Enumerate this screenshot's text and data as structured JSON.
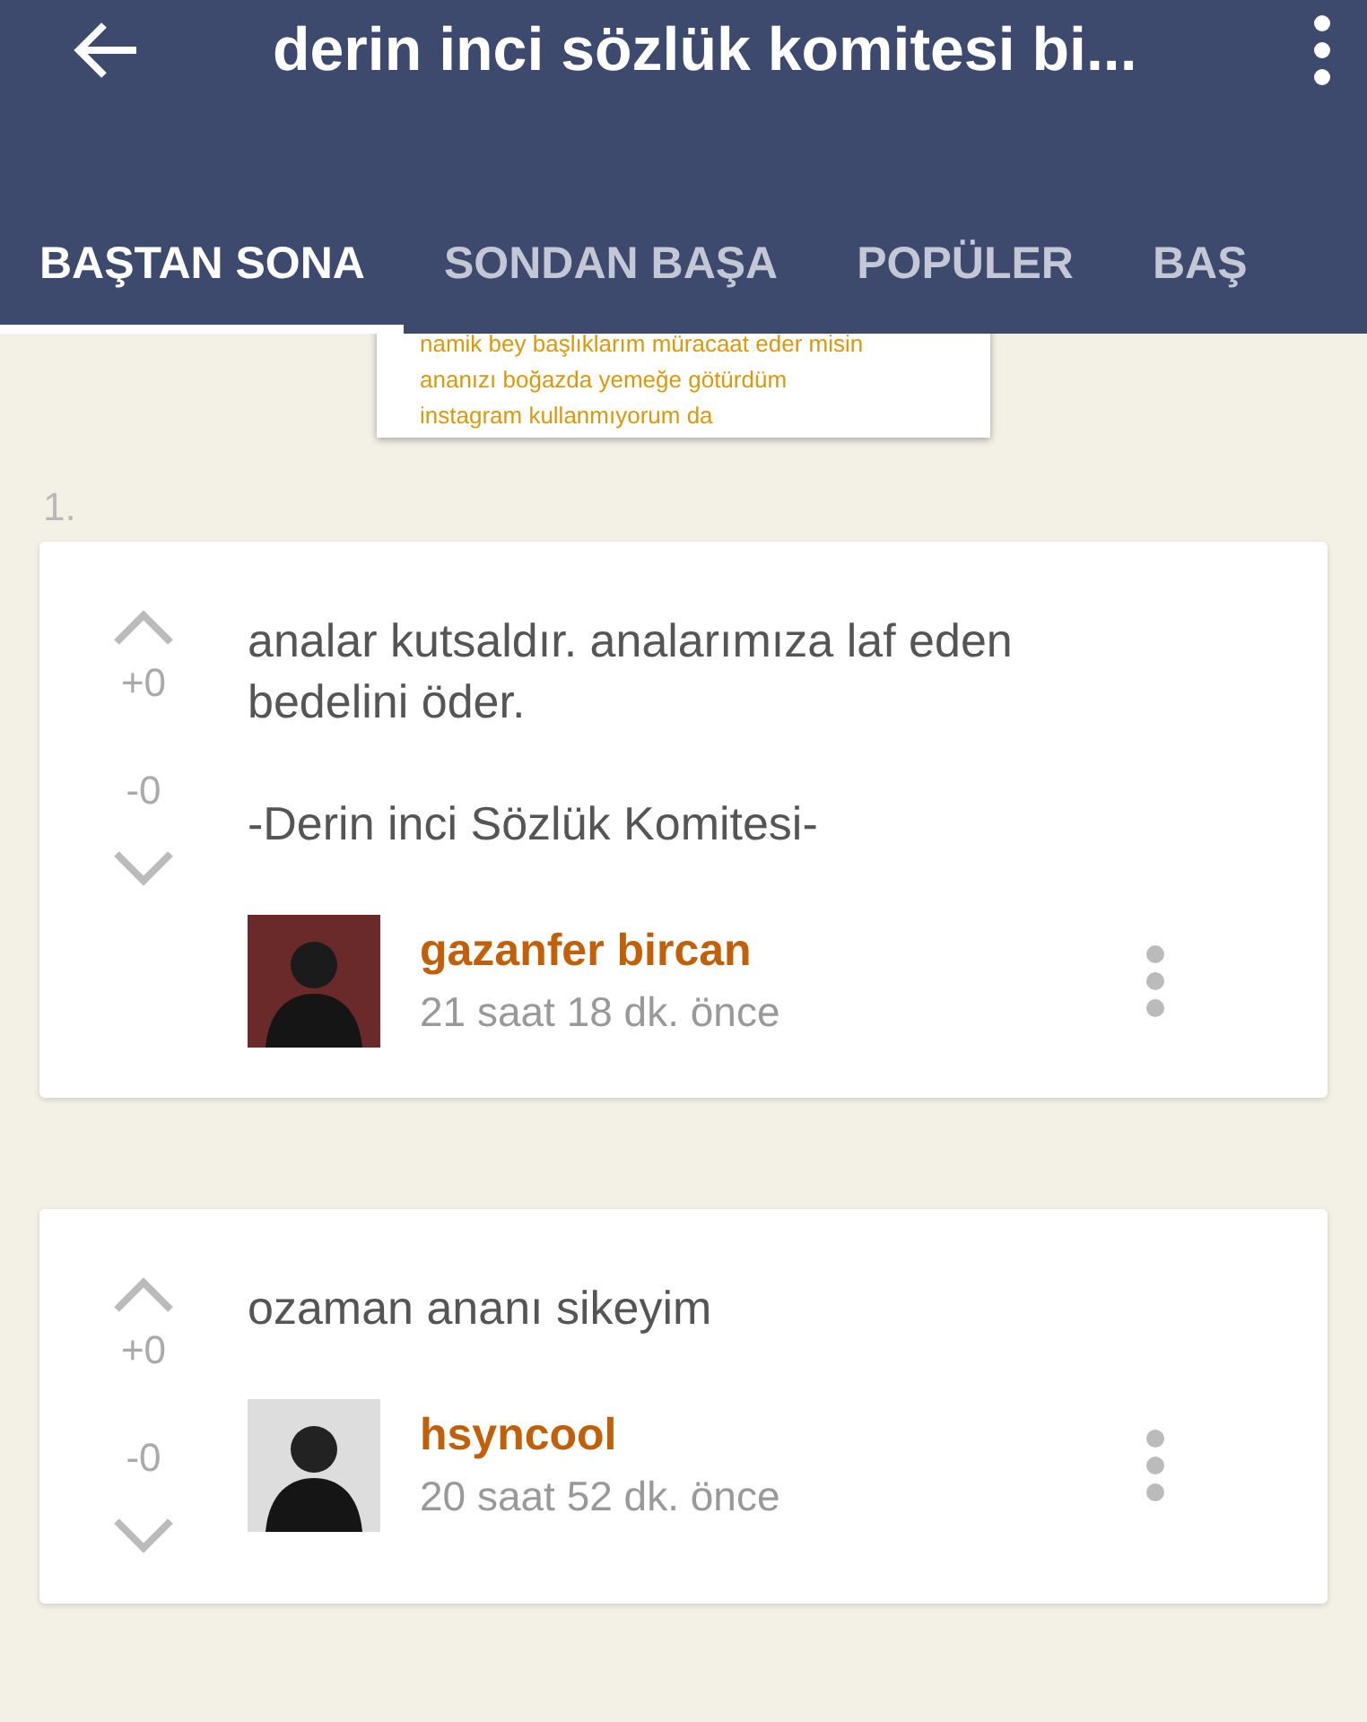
{
  "app_bar": {
    "title": "derin inci sözlük komitesi bi..."
  },
  "tabs": [
    {
      "label": "BAŞTAN SONA",
      "selected": true
    },
    {
      "label": "SONDAN BAŞA",
      "selected": false
    },
    {
      "label": "POPÜLER",
      "selected": false
    },
    {
      "label": "BAŞ",
      "selected": false
    }
  ],
  "popup_card": {
    "lines": [
      "namik bey başlıklarım müracaat eder misin",
      "ananızı boğazda yemeğe götürdüm",
      "instagram kullanmıyorum da"
    ]
  },
  "entries": [
    {
      "number": "1.",
      "paragraphs": [
        "analar kutsaldır. analarımıza laf eden bedelini öder.",
        "-Derin inci Sözlük Komitesi-"
      ],
      "upvotes": "+0",
      "downvotes": "-0",
      "author": "gazanfer bircan",
      "time": "21 saat 18 dk. önce"
    },
    {
      "paragraphs": [
        "ozaman ananı sikeyim"
      ],
      "upvotes": "+0",
      "downvotes": "-0",
      "author": "hsyncool",
      "time": "20 saat 52 dk. önce"
    }
  ]
}
